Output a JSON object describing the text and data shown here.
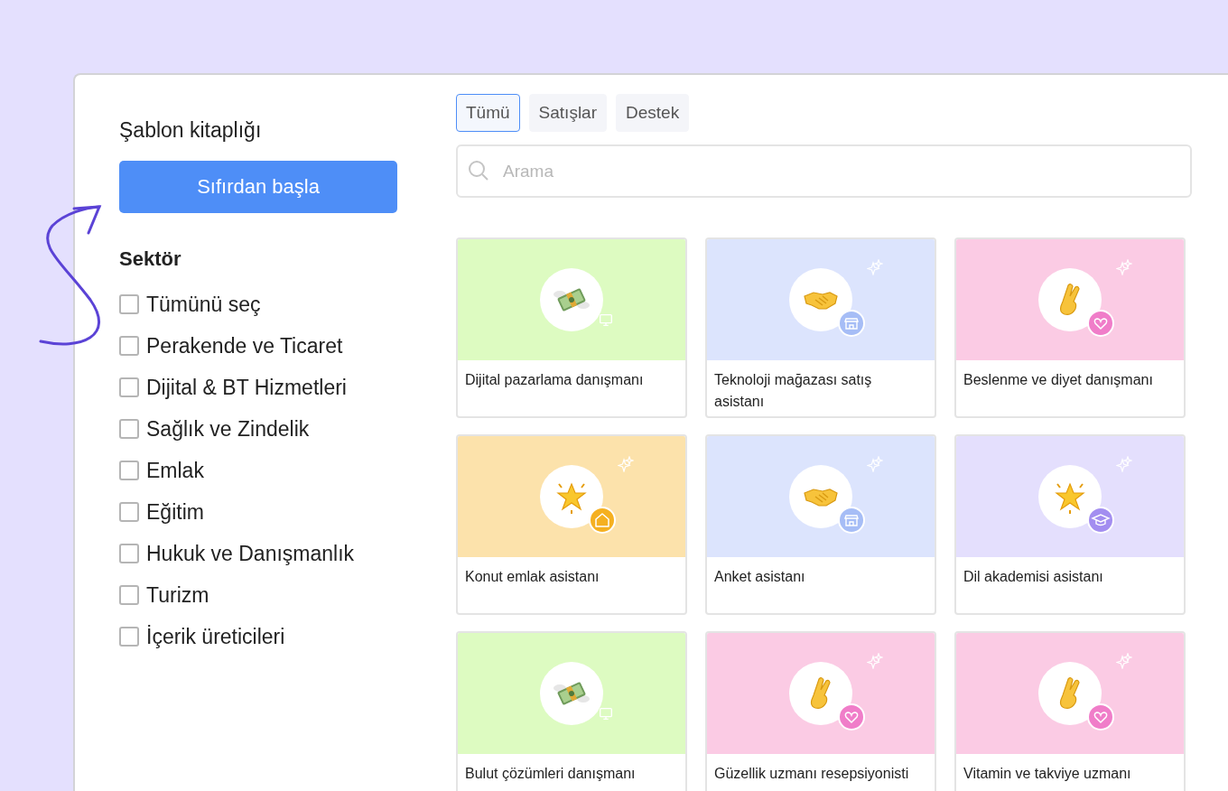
{
  "sidebar": {
    "title": "Şablon kitaplığı",
    "start_button": "Sıfırdan başla",
    "filter_heading": "Sektör",
    "filters": [
      {
        "label": "Tümünü seç",
        "checked": false
      },
      {
        "label": "Perakende ve Ticaret",
        "checked": false
      },
      {
        "label": "Dijital & BT Hizmetleri",
        "checked": false
      },
      {
        "label": "Sağlık ve Zindelik",
        "checked": false
      },
      {
        "label": "Emlak",
        "checked": false
      },
      {
        "label": "Eğitim",
        "checked": false
      },
      {
        "label": "Hukuk ve Danışmanlık",
        "checked": false
      },
      {
        "label": "Turizm",
        "checked": false
      },
      {
        "label": "İçerik üreticileri",
        "checked": false
      }
    ]
  },
  "tabs": [
    {
      "label": "Tümü",
      "selected": true
    },
    {
      "label": "Satışlar",
      "selected": false
    },
    {
      "label": "Destek",
      "selected": false
    }
  ],
  "search": {
    "placeholder": "Arama"
  },
  "templates": [
    {
      "title": "Dijital pazarlama danışmanı",
      "color": "#ddfbc1",
      "emoji": {
        "kind": "money"
      },
      "badge": {
        "kind": "monitor"
      },
      "sparkle": false
    },
    {
      "title": "Teknoloji mağazası satış asistanı",
      "color": "#dce4fd",
      "emoji": {
        "kind": "handshake"
      },
      "badge": {
        "kind": "store"
      },
      "sparkle": true
    },
    {
      "title": "Beslenme ve diyet danışmanı",
      "color": "#fbcbe4",
      "emoji": {
        "kind": "fingers"
      },
      "badge": {
        "kind": "heart"
      },
      "sparkle": true
    },
    {
      "title": "Konut emlak asistanı",
      "color": "#fce2ab",
      "emoji": {
        "kind": "star"
      },
      "badge": {
        "kind": "home"
      },
      "sparkle": true
    },
    {
      "title": "Anket asistanı",
      "color": "#dce4fd",
      "emoji": {
        "kind": "handshake"
      },
      "badge": {
        "kind": "store"
      },
      "sparkle": true
    },
    {
      "title": "Dil akademisi asistanı",
      "color": "#e4dffd",
      "emoji": {
        "kind": "star"
      },
      "badge": {
        "kind": "cap"
      },
      "sparkle": true
    },
    {
      "title": "Bulut çözümleri danışmanı",
      "color": "#ddfbc1",
      "emoji": {
        "kind": "money"
      },
      "badge": {
        "kind": "monitor"
      },
      "sparkle": false
    },
    {
      "title": "Güzellik uzmanı resepsiyonisti",
      "color": "#fbcbe4",
      "emoji": {
        "kind": "fingers"
      },
      "badge": {
        "kind": "heart"
      },
      "sparkle": true
    },
    {
      "title": "Vitamin ve takviye uzmanı",
      "color": "#fbcbe4",
      "emoji": {
        "kind": "fingers"
      },
      "badge": {
        "kind": "heart"
      },
      "sparkle": true
    }
  ]
}
